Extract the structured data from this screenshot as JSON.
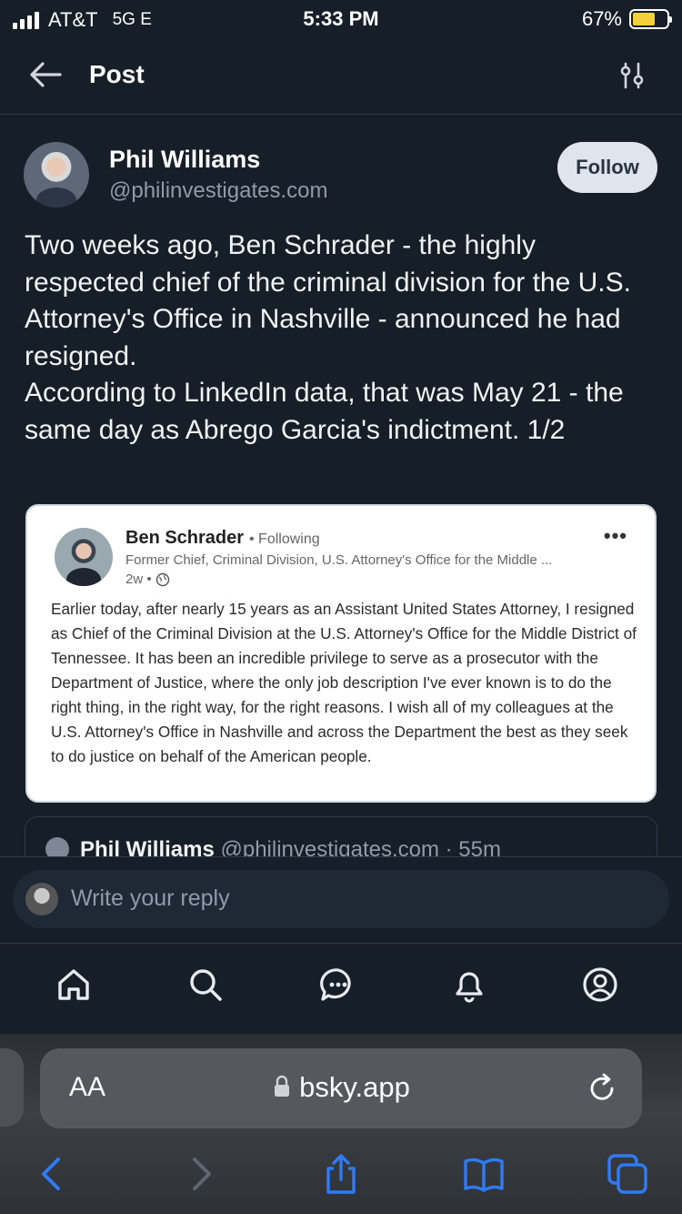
{
  "status_bar": {
    "carrier": "AT&T",
    "network": "5G E",
    "time": "5:33 PM",
    "battery": "67%",
    "battery_level": 0.67
  },
  "header": {
    "title": "Post"
  },
  "post": {
    "author_name": "Phil Williams",
    "author_handle": "@philinvestigates.com",
    "follow_label": "Follow",
    "text": "Two weeks ago, Ben Schrader - the highly respected chief of the criminal division for the U.S. Attorney's Office in Nashville - announced he had resigned.\nAccording to LinkedIn data, that was May 21 - the same day as Abrego Garcia's indictment. 1/2"
  },
  "embed": {
    "name": "Ben Schrader",
    "following": "• Following",
    "subtitle": "Former Chief, Criminal Division, U.S. Attorney's Office for the Middle ...",
    "time": "2w •",
    "more": "•••",
    "body": "Earlier today, after nearly 15 years as an Assistant United States Attorney, I resigned as Chief of the Criminal Division at the U.S. Attorney's Office for the Middle District of Tennessee. It has been an incredible privilege to serve as a prosecutor with the Department of Justice, where the only job description I've ever known is to do the right thing, in the right way, for the right reasons. I wish all of my colleagues at the U.S. Attorney's Office in Nashville and across the Department the best as they seek to do justice on behalf of the American people."
  },
  "next_post": {
    "name": "Phil Williams",
    "meta": "@philinvestigates.com · 55m"
  },
  "reply": {
    "placeholder": "Write your reply"
  },
  "safari": {
    "aa": "AA",
    "url": "bsky.app"
  },
  "icons": {
    "tabs": [
      "home-icon",
      "search-icon",
      "chat-icon",
      "bell-icon",
      "profile-icon"
    ],
    "toolbar": [
      "back-chevron-icon",
      "forward-chevron-icon",
      "share-icon",
      "bookmarks-icon",
      "tabs-icon"
    ],
    "accent": "#2f7bf6"
  }
}
